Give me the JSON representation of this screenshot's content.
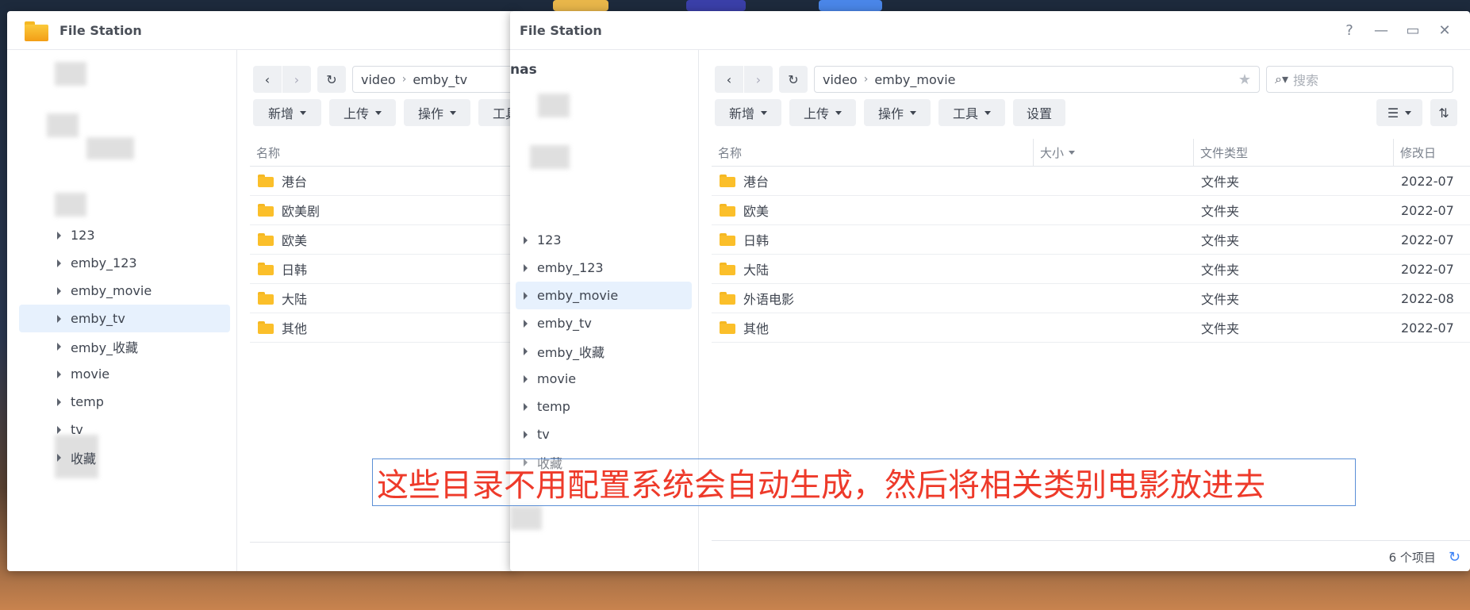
{
  "left_window": {
    "title": "File Station",
    "path": [
      "video",
      "emby_tv"
    ],
    "toolbar": [
      "新增",
      "上传",
      "操作",
      "工具"
    ],
    "list_header": {
      "name": "名称"
    },
    "tree": [
      "123",
      "emby_123",
      "emby_movie",
      "emby_tv",
      "emby_收藏",
      "movie",
      "temp",
      "tv",
      "收藏"
    ],
    "selected_tree": "emby_tv",
    "files": [
      "港台",
      "欧美剧",
      "欧美",
      "日韩",
      "大陆",
      "其他"
    ]
  },
  "right_window": {
    "title": "File Station",
    "controls": {
      "help": "?",
      "minimize": "—",
      "maximize": "▭",
      "close": "✕"
    },
    "sidebar_root": "nas",
    "path": [
      "video",
      "emby_movie"
    ],
    "search_placeholder": "搜索",
    "toolbar": {
      "add": "新增",
      "upload": "上传",
      "action": "操作",
      "tools": "工具",
      "settings": "设置"
    },
    "list_header": {
      "name": "名称",
      "size": "大小",
      "type": "文件类型",
      "modified": "修改日"
    },
    "tree": [
      "123",
      "emby_123",
      "emby_movie",
      "emby_tv",
      "emby_收藏",
      "movie",
      "temp",
      "tv",
      "收藏"
    ],
    "selected_tree": "emby_movie",
    "files": [
      {
        "name": "港台",
        "type": "文件夹",
        "modified": "2022-07"
      },
      {
        "name": "欧美",
        "type": "文件夹",
        "modified": "2022-07"
      },
      {
        "name": "日韩",
        "type": "文件夹",
        "modified": "2022-07"
      },
      {
        "name": "大陆",
        "type": "文件夹",
        "modified": "2022-07"
      },
      {
        "name": "外语电影",
        "type": "文件夹",
        "modified": "2022-08"
      },
      {
        "name": "其他",
        "type": "文件夹",
        "modified": "2022-07"
      }
    ],
    "item_count": "6 个项目"
  },
  "caption": "这些目录不用配置系统会自动生成，然后将相关类别电影放进去",
  "colors": {
    "accent": "#3b82f6",
    "caption": "#ee3a2a",
    "folder": "#fbbf2a",
    "selected": "#e7f1fd"
  }
}
